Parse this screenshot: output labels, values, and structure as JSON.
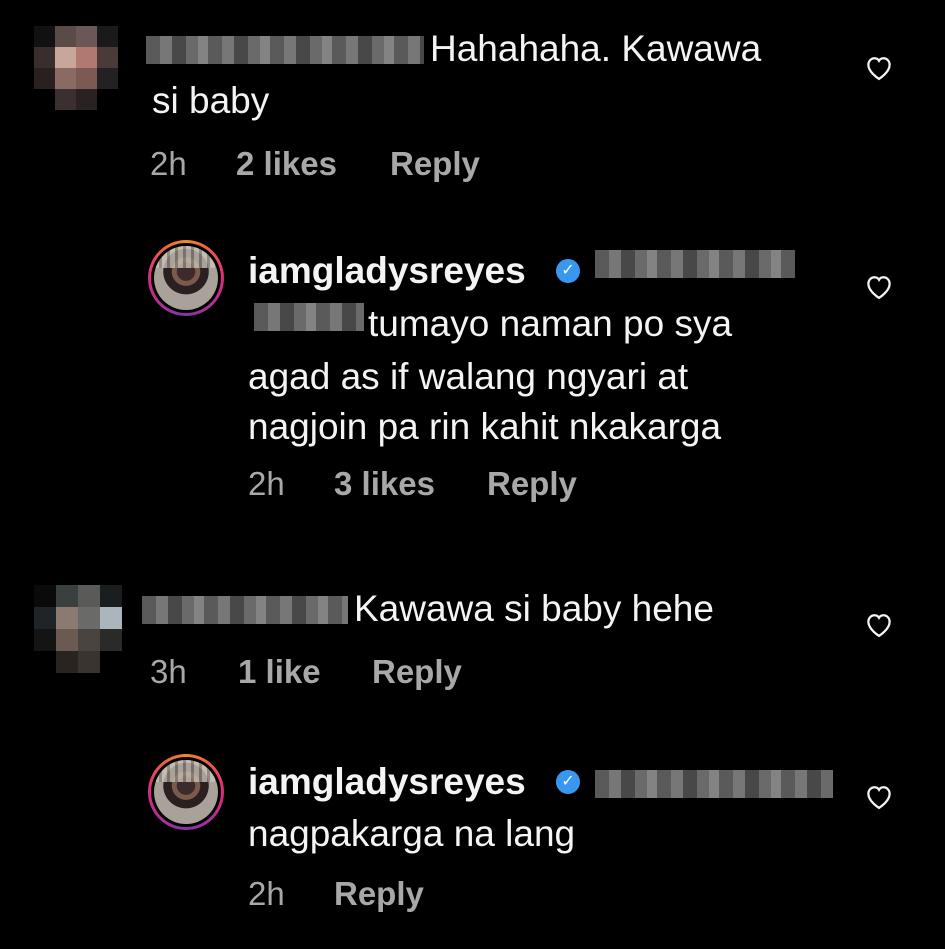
{
  "comments": [
    {
      "text_line1": "Hahahaha. Kawawa",
      "text_line2": "si baby",
      "time": "2h",
      "likes": "2 likes",
      "reply": "Reply"
    },
    {
      "username": "iamgladysreyes",
      "text_line1": "tumayo naman po sya",
      "text_line2": "agad as if walang ngyari at",
      "text_line3": "nagjoin pa rin kahit nkakarga",
      "time": "2h",
      "likes": "3 likes",
      "reply": "Reply"
    },
    {
      "text_line1": "Kawawa si baby hehe",
      "time": "3h",
      "likes": "1 like",
      "reply": "Reply"
    },
    {
      "username": "iamgladysreyes",
      "text_line1": "nagpakarga na lang",
      "time": "2h",
      "reply": "Reply"
    }
  ],
  "icons": {
    "like": "heart-outline-icon",
    "verified": "verified-badge-icon"
  },
  "colors": {
    "background": "#000000",
    "text": "#f4f4f4",
    "meta": "#a8a8a8",
    "verified": "#3897f0"
  }
}
